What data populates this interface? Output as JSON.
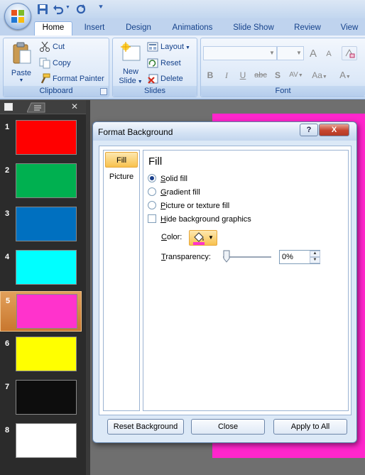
{
  "app": {
    "tabs": [
      "Home",
      "Insert",
      "Design",
      "Animations",
      "Slide Show",
      "Review",
      "View"
    ],
    "active_tab": "Home"
  },
  "ribbon": {
    "clipboard": {
      "paste": "Paste",
      "cut": "Cut",
      "copy": "Copy",
      "format_painter": "Format Painter",
      "label": "Clipboard"
    },
    "slides": {
      "new_slide_1": "New",
      "new_slide_2": "Slide",
      "layout": "Layout",
      "reset": "Reset",
      "delete": "Delete",
      "label": "Slides"
    },
    "font": {
      "label": "Font",
      "bold": "B",
      "italic": "I",
      "underline": "U",
      "strike": "abc",
      "shadow": "S",
      "spacing": "AV",
      "case": "Aa",
      "color": "A",
      "grow": "A",
      "shrink": "A"
    }
  },
  "slides_panel": {
    "slides": [
      {
        "num": "1",
        "color": "#ff0000"
      },
      {
        "num": "2",
        "color": "#00b050"
      },
      {
        "num": "3",
        "color": "#0070c0"
      },
      {
        "num": "4",
        "color": "#00ffff"
      },
      {
        "num": "5",
        "color": "#ff33cc"
      },
      {
        "num": "6",
        "color": "#ffff00"
      },
      {
        "num": "7",
        "color": "#0d0d0d"
      },
      {
        "num": "8",
        "color": "#ffffff"
      }
    ],
    "selected": "5"
  },
  "dialog": {
    "title": "Format Background",
    "help": "?",
    "close": "X",
    "nav": [
      "Fill",
      "Picture"
    ],
    "heading": "Fill",
    "options": {
      "solid_u": "S",
      "solid_rest": "olid fill",
      "gradient_u": "G",
      "gradient_rest": "radient fill",
      "picture_u": "P",
      "picture_rest": "icture or texture fill",
      "hide_u": "H",
      "hide_rest": "ide background graphics"
    },
    "color_u": "C",
    "color_rest": "olor:",
    "transparency_u": "T",
    "transparency_rest": "ransparency:",
    "transparency_value": "0%",
    "buttons": {
      "reset": "Reset Background",
      "close": "Close",
      "apply": "Apply to All"
    }
  },
  "colors": {
    "accent_pink": "#ff26cc",
    "fill_color": "#ff33cc"
  }
}
